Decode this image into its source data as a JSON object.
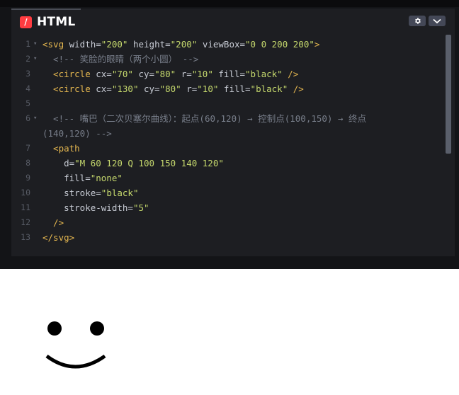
{
  "panel": {
    "language_icon": "/",
    "title": "HTML",
    "settings_icon": "gear-icon",
    "collapse_icon": "chevron-down-icon"
  },
  "editor": {
    "line_numbers": [
      "1",
      "2",
      "3",
      "4",
      "5",
      "6",
      "",
      "7",
      "8",
      "9",
      "10",
      "11",
      "12",
      "13"
    ],
    "lines": [
      {
        "n": "1",
        "fold": true,
        "tokens": [
          [
            "t-tag",
            "<svg"
          ],
          [
            "t-attr",
            " width="
          ],
          [
            "t-str",
            "\"200\""
          ],
          [
            "t-attr",
            " height="
          ],
          [
            "t-str",
            "\"200\""
          ],
          [
            "t-attr",
            " viewBox="
          ],
          [
            "t-str",
            "\"0 0 200 200\""
          ],
          [
            "t-tag",
            ">"
          ]
        ]
      },
      {
        "n": "2",
        "fold": true,
        "tokens": [
          [
            "t-com",
            "  <!-- 笑脸的眼睛（两个小圆） -->"
          ]
        ]
      },
      {
        "n": "3",
        "fold": false,
        "tokens": [
          [
            "t-tag",
            "  <circle"
          ],
          [
            "t-attr",
            " cx="
          ],
          [
            "t-str",
            "\"70\""
          ],
          [
            "t-attr",
            " cy="
          ],
          [
            "t-str",
            "\"80\""
          ],
          [
            "t-attr",
            " r="
          ],
          [
            "t-str",
            "\"10\""
          ],
          [
            "t-attr",
            " fill="
          ],
          [
            "t-str",
            "\"black\""
          ],
          [
            "t-tag",
            " />"
          ]
        ]
      },
      {
        "n": "4",
        "fold": false,
        "tokens": [
          [
            "t-tag",
            "  <circle"
          ],
          [
            "t-attr",
            " cx="
          ],
          [
            "t-str",
            "\"130\""
          ],
          [
            "t-attr",
            " cy="
          ],
          [
            "t-str",
            "\"80\""
          ],
          [
            "t-attr",
            " r="
          ],
          [
            "t-str",
            "\"10\""
          ],
          [
            "t-attr",
            " fill="
          ],
          [
            "t-str",
            "\"black\""
          ],
          [
            "t-tag",
            " />"
          ]
        ]
      },
      {
        "n": "5",
        "fold": false,
        "tokens": []
      },
      {
        "n": "6",
        "fold": true,
        "tokens": [
          [
            "t-com",
            "  <!-- 嘴巴（二次贝塞尔曲线）：起点(60,120) → 控制点(100,150) → 终点"
          ]
        ]
      },
      {
        "n": "",
        "fold": false,
        "tokens": [
          [
            "t-com",
            "(140,120) -->"
          ]
        ]
      },
      {
        "n": "7",
        "fold": false,
        "tokens": [
          [
            "t-tag",
            "  <path"
          ]
        ]
      },
      {
        "n": "8",
        "fold": false,
        "tokens": [
          [
            "t-attr",
            "    d="
          ],
          [
            "t-str",
            "\"M 60 120 Q 100 150 140 120\""
          ]
        ]
      },
      {
        "n": "9",
        "fold": false,
        "tokens": [
          [
            "t-attr",
            "    fill="
          ],
          [
            "t-str",
            "\"none\""
          ]
        ]
      },
      {
        "n": "10",
        "fold": false,
        "tokens": [
          [
            "t-attr",
            "    stroke="
          ],
          [
            "t-str",
            "\"black\""
          ]
        ]
      },
      {
        "n": "11",
        "fold": false,
        "tokens": [
          [
            "t-attr",
            "    stroke-width="
          ],
          [
            "t-str",
            "\"5\""
          ]
        ]
      },
      {
        "n": "12",
        "fold": false,
        "tokens": [
          [
            "t-tag",
            "  />"
          ]
        ]
      },
      {
        "n": "13",
        "fold": false,
        "tokens": [
          [
            "t-tag",
            "</svg>"
          ]
        ]
      }
    ]
  },
  "preview": {
    "description_icon": "smiley-face-icon",
    "eye_color": "#000000",
    "mouth_color": "#000000"
  }
}
